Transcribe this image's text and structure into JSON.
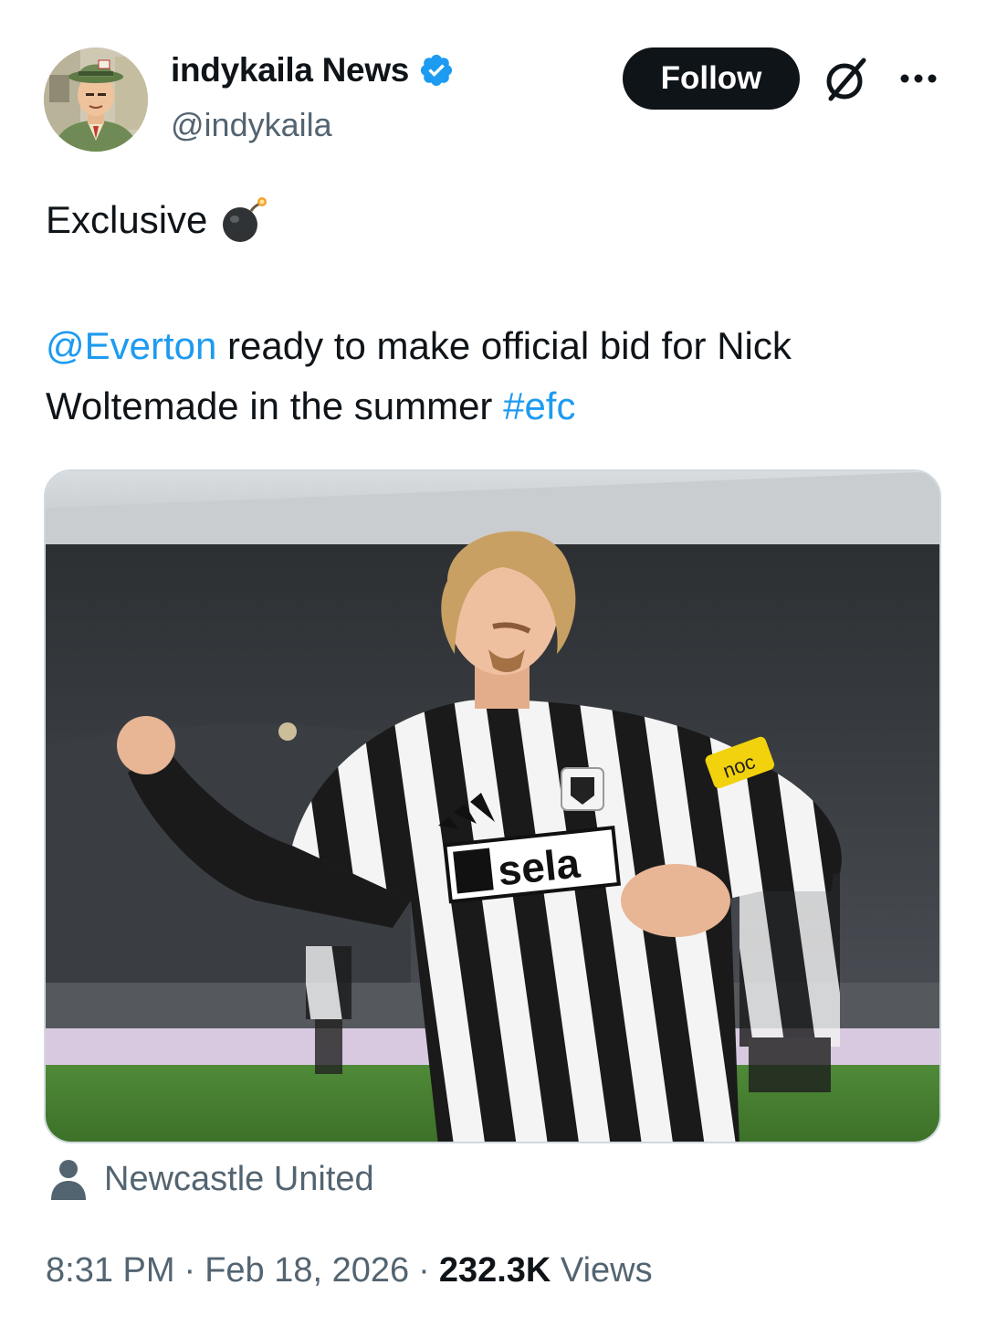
{
  "author": {
    "display_name": "indykaila News",
    "handle": "@indykaila",
    "verified": true,
    "verified_color": "#1d9bf0",
    "avatar_icon": "cartoon-man-avatar"
  },
  "header": {
    "follow_label": "Follow",
    "grok_icon": "grok-icon",
    "more_icon": "more-options-icon"
  },
  "tweet": {
    "line1": "Exclusive",
    "line1_emoji": "bomb-icon",
    "mention": "@Everton",
    "body_text": " ready to make official bid for Nick Woltemade in the summer ",
    "hashtag": "#efc",
    "link_color": "#1d9bf0"
  },
  "media": {
    "description_icon": "football-player-photo",
    "sponsor_text": "sela",
    "armband_text": "noc"
  },
  "tagged": {
    "icon": "person-icon",
    "label": "Newcastle United"
  },
  "meta": {
    "time": "8:31 PM",
    "separator": "·",
    "date": "Feb 18, 2026",
    "views_count": "232.3K",
    "views_label": "Views"
  }
}
